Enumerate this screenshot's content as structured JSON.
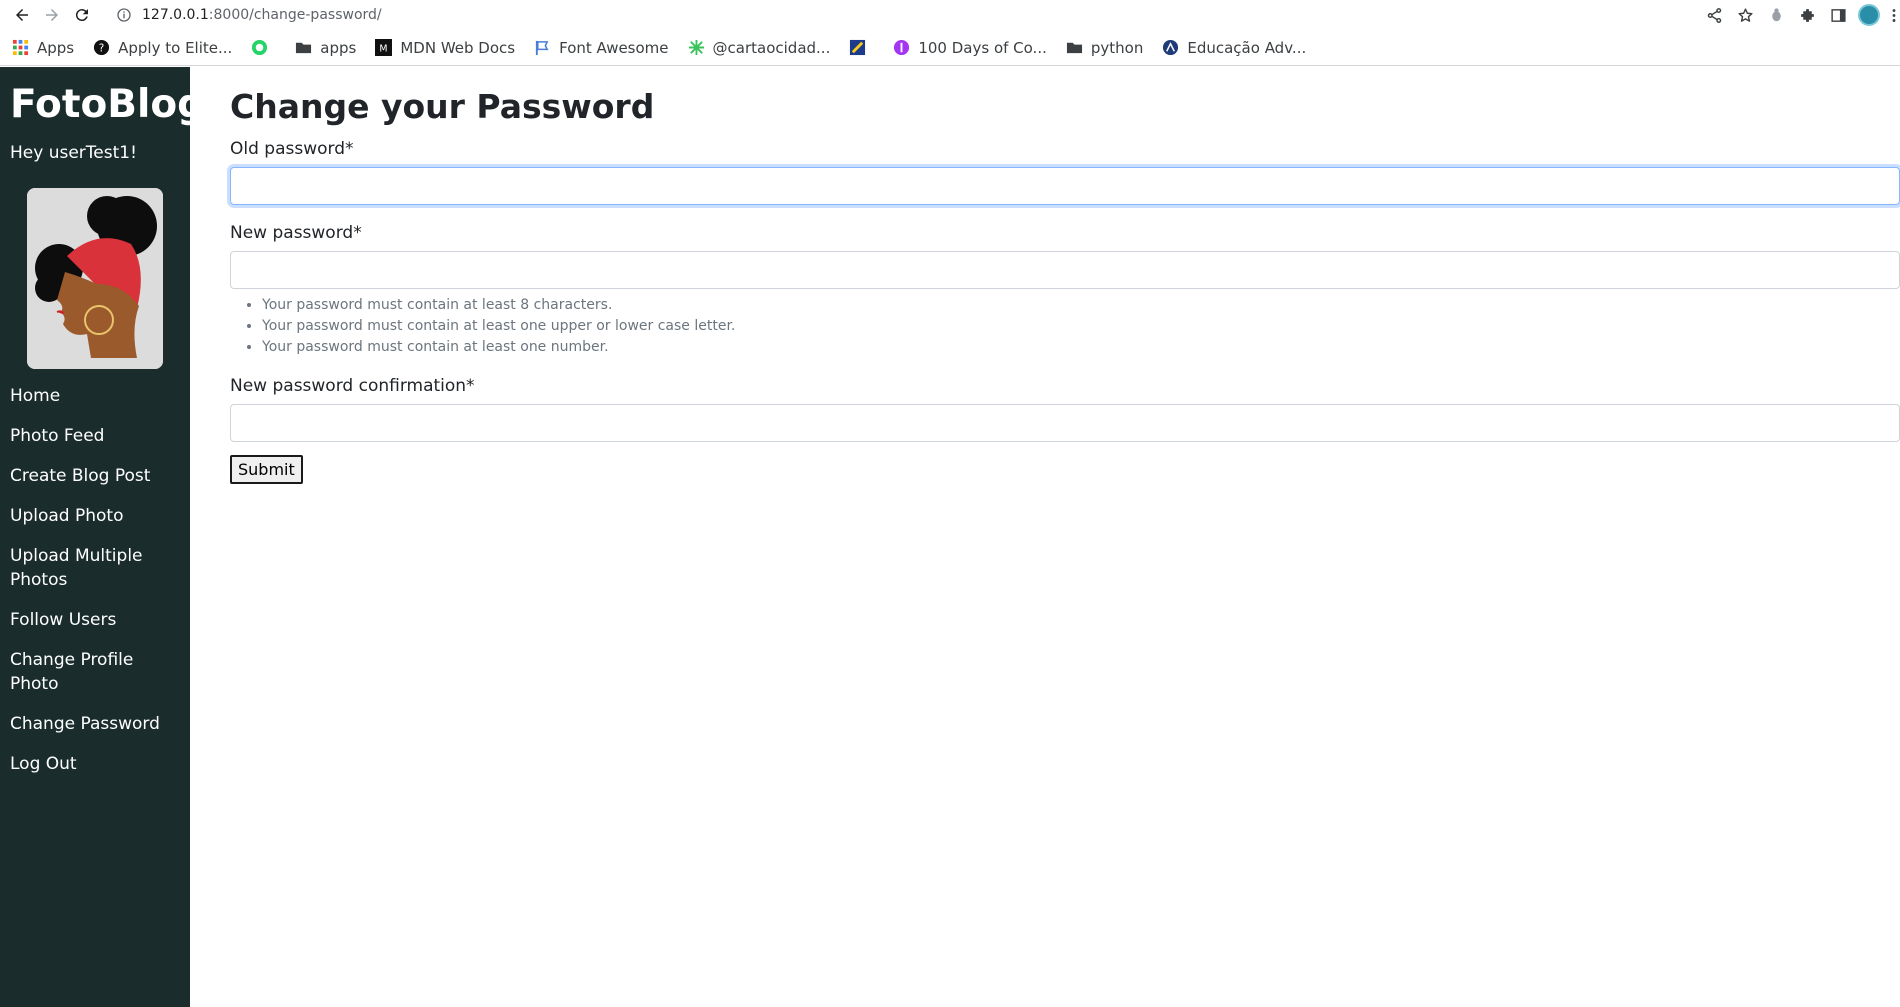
{
  "browser": {
    "url_host": "127.0.0.1",
    "url_path": ":8000/change-password/",
    "bookmarks": [
      {
        "label": "Apps",
        "icon": "apps-grid-icon"
      },
      {
        "label": "Apply to Elite...",
        "icon": "site-icon"
      },
      {
        "label": "",
        "icon": "whatsapp-icon"
      },
      {
        "label": "apps",
        "icon": "folder-icon"
      },
      {
        "label": "MDN Web Docs",
        "icon": "mdn-icon"
      },
      {
        "label": "Font Awesome",
        "icon": "flag-icon"
      },
      {
        "label": "@cartaocidad...",
        "icon": "asterisk-icon"
      },
      {
        "label": "",
        "icon": "site-icon"
      },
      {
        "label": "100 Days of Co...",
        "icon": "site-icon"
      },
      {
        "label": "python",
        "icon": "folder-icon"
      },
      {
        "label": "Educação Adv...",
        "icon": "site-icon"
      }
    ]
  },
  "sidebar": {
    "brand": "FotoBlog",
    "greeting": "Hey userTest1!",
    "menu": [
      "Home",
      "Photo Feed",
      "Create Blog Post",
      "Upload Photo",
      "Upload Multiple Photos",
      "Follow Users",
      "Change Profile Photo",
      "Change Password",
      "Log Out"
    ]
  },
  "main": {
    "title": "Change your Password",
    "old_password_label": "Old password*",
    "old_password_value": "",
    "new_password_label": "New password*",
    "new_password_value": "",
    "help_texts": [
      "Your password must contain at least 8 characters.",
      "Your password must contain at least one upper or lower case letter.",
      "Your password must contain at least one number."
    ],
    "confirm_label": "New password confirmation*",
    "confirm_value": "",
    "submit_label": "Submit"
  },
  "colors": {
    "sidebar_bg": "#1b2c2c",
    "focus_ring": "#86b7fe",
    "help_text": "#6c757d"
  }
}
